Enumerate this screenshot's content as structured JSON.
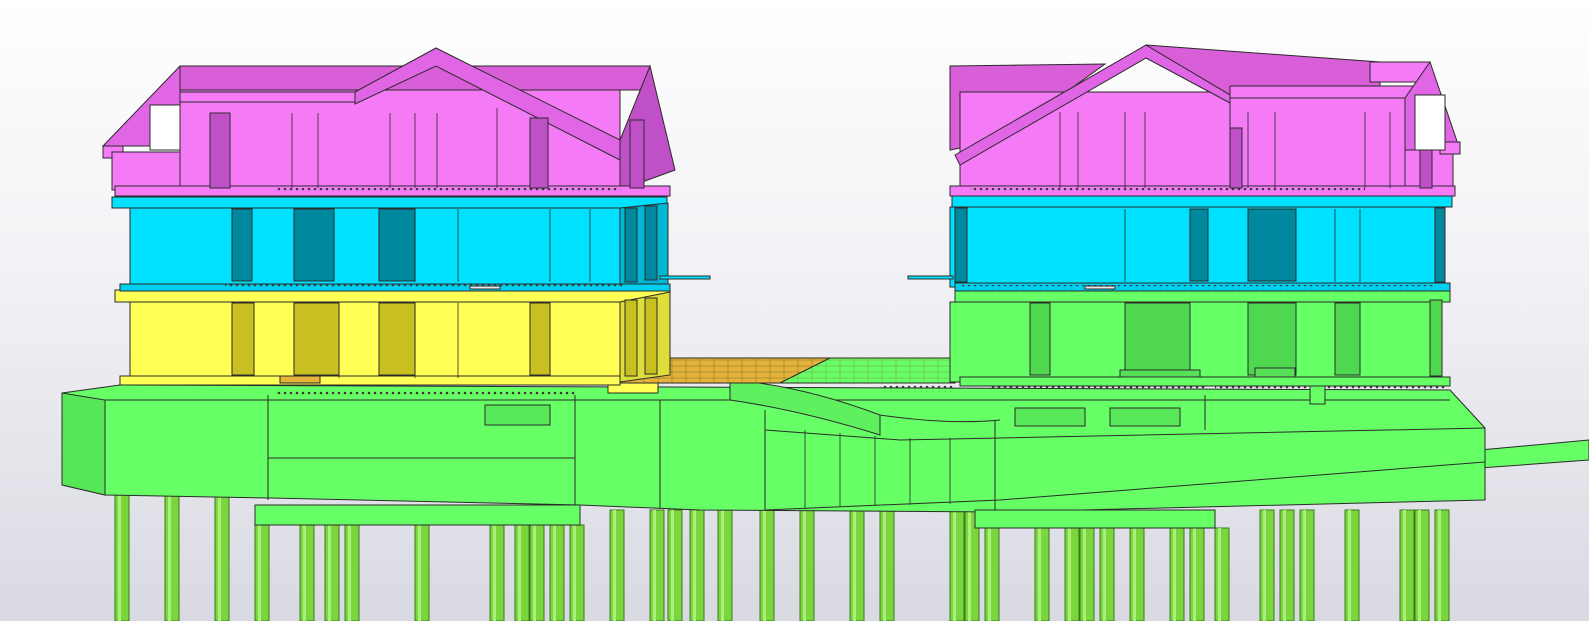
{
  "viewport": {
    "view": "3D model view",
    "background": [
      "#ffffff",
      "#d9d9e2"
    ]
  },
  "colors": {
    "roof_level": "#f57af5",
    "upper_level": "#00e0ff",
    "ground_level_left": "#ffff55",
    "foundation": "#66ff66",
    "piles": "#7ad63c",
    "timber_deck": "#e6b33a",
    "edge": "#2b2b2b"
  },
  "model": {
    "buildings": [
      {
        "name": "left-building",
        "levels": [
          "roof",
          "upper",
          "ground"
        ]
      },
      {
        "name": "right-building",
        "levels": [
          "roof",
          "upper",
          "ground"
        ]
      }
    ],
    "has_connecting_deck": true,
    "has_pile_foundation": true
  }
}
